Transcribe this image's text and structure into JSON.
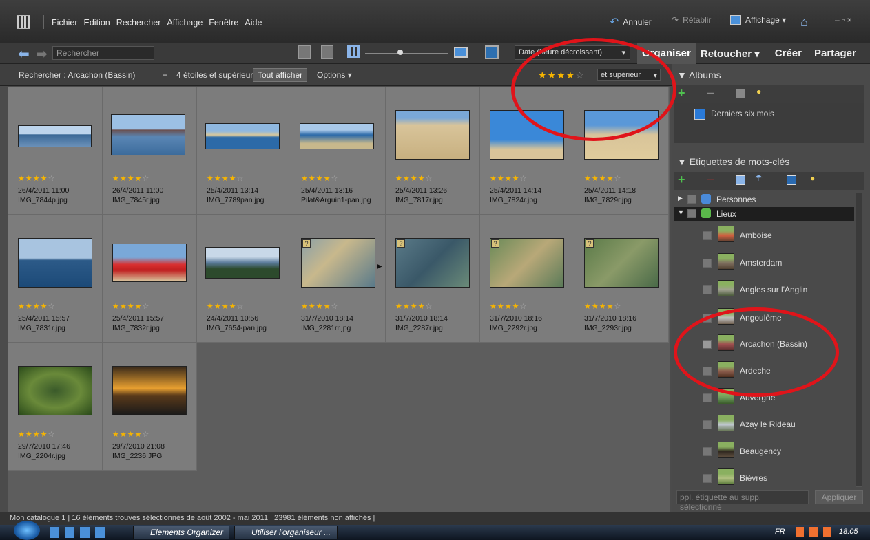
{
  "menu": [
    "Fichier",
    "Edition",
    "Rechercher",
    "Affichage",
    "Fenêtre",
    "Aide"
  ],
  "undo": "Annuler",
  "redo": "Rétablir",
  "view": "Affichage ▾",
  "winctl": "– ▫ ×",
  "search_placeholder": "Rechercher",
  "date_sort": "Date (heure décroissant)",
  "tabs": [
    "Organiser",
    "Retoucher ▾",
    "Créer",
    "Partager"
  ],
  "filter": {
    "label": "Rechercher : Arcachon (Bassin)",
    "plus": "+",
    "rating": "4 étoiles et supérieur",
    "show_all": "Tout afficher",
    "options": "Options ▾",
    "stars": "★★★★",
    "star_empty": "☆",
    "sup": "et supérieur"
  },
  "photos": [
    {
      "stars": "★★★★",
      "empty": "☆",
      "date": "26/4/2011 11:00",
      "name": "IMG_7844p.jpg"
    },
    {
      "stars": "★★★★",
      "empty": "☆",
      "date": "26/4/2011 11:00",
      "name": "IMG_7845r.jpg"
    },
    {
      "stars": "★★★★",
      "empty": "☆",
      "date": "25/4/2011 13:14",
      "name": "IMG_7789pan.jpg"
    },
    {
      "stars": "★★★★",
      "empty": "☆",
      "date": "25/4/2011 13:16",
      "name": "Pilat&Arguin1-pan.jpg"
    },
    {
      "stars": "★★★★",
      "empty": "☆",
      "date": "25/4/2011 13:26",
      "name": "IMG_7817r.jpg"
    },
    {
      "stars": "★★★★",
      "empty": "☆",
      "date": "25/4/2011 14:14",
      "name": "IMG_7824r.jpg"
    },
    {
      "stars": "★★★★",
      "empty": "☆",
      "date": "25/4/2011 14:18",
      "name": "IMG_7829r.jpg"
    },
    {
      "stars": "★★★★",
      "empty": "☆",
      "date": "25/4/2011 15:57",
      "name": "IMG_7831r.jpg"
    },
    {
      "stars": "★★★★",
      "empty": "☆",
      "date": "25/4/2011 15:57",
      "name": "IMG_7832r.jpg"
    },
    {
      "stars": "★★★★",
      "empty": "☆",
      "date": "24/4/2011 10:56",
      "name": "IMG_7654-pan.jpg"
    },
    {
      "stars": "★★★★",
      "empty": "☆",
      "date": "31/7/2010 18:14",
      "name": "IMG_2281rr.jpg"
    },
    {
      "stars": "★★★★",
      "empty": "☆",
      "date": "31/7/2010 18:14",
      "name": "IMG_2287r.jpg"
    },
    {
      "stars": "★★★★",
      "empty": "☆",
      "date": "31/7/2010 18:16",
      "name": "IMG_2292r.jpg"
    },
    {
      "stars": "★★★★",
      "empty": "☆",
      "date": "31/7/2010 18:16",
      "name": "IMG_2293r.jpg"
    },
    {
      "stars": "★★★★",
      "empty": "☆",
      "date": "29/7/2010 17:46",
      "name": "IMG_2204r.jpg"
    },
    {
      "stars": "★★★★",
      "empty": "☆",
      "date": "29/7/2010 21:08",
      "name": "IMG_2236.JPG"
    }
  ],
  "albums": {
    "title": "Albums",
    "item": "Derniers six mois"
  },
  "keywords": {
    "title": "Etiquettes de mots-clés",
    "people": "Personnes",
    "places": "Lieux",
    "items": [
      "Amboise",
      "Amsterdam",
      "Angles sur l'Anglin",
      "Angoulême",
      "Arcachon (Bassin)",
      "Ardeche",
      "Auvergne",
      "Azay le Rideau",
      "Beaugency",
      "Bièvres"
    ]
  },
  "apply_placeholder": "ppl. étiquette au supp. sélectionné",
  "apply_button": "Appliquer",
  "status": "Mon catalogue 1  |  16 éléments trouvés sélectionnés de août 2002 - mai 2011  |  23981 éléments non affichés  |",
  "taskbar": {
    "btn1": "Elements Organizer",
    "btn2": "Utiliser l'organiseur ...",
    "lang": "FR",
    "time": "18:05"
  }
}
